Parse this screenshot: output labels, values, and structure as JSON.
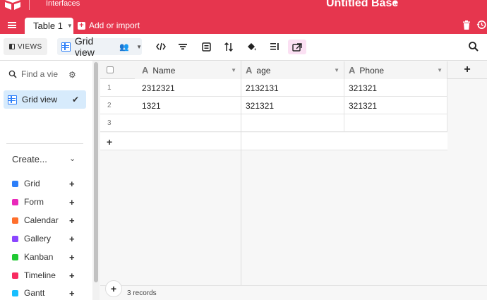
{
  "header": {
    "section_label": "Interfaces",
    "base_title": "Untitled Base"
  },
  "tabs": {
    "active_table": "Table 1",
    "add_import_label": "Add or import"
  },
  "viewbar": {
    "views_label": "VIEWS",
    "current_view": "Grid view",
    "tools": [
      "code-icon",
      "filter-icon",
      "group-icon",
      "sort-icon",
      "color-icon",
      "row-height-icon",
      "share-icon"
    ]
  },
  "sidebar": {
    "find_placeholder": "Find a view",
    "active_view": "Grid view",
    "create_label": "Create...",
    "create_items": [
      {
        "label": "Grid",
        "color": "#2d7ff9"
      },
      {
        "label": "Form",
        "color": "#e929ba"
      },
      {
        "label": "Calendar",
        "color": "#ff6f2c"
      },
      {
        "label": "Gallery",
        "color": "#8b46ff"
      },
      {
        "label": "Kanban",
        "color": "#20c933"
      },
      {
        "label": "Timeline",
        "color": "#f82b60"
      },
      {
        "label": "Gantt",
        "color": "#18bfff"
      }
    ]
  },
  "grid": {
    "columns": [
      "Name",
      "age",
      "Phone"
    ],
    "rows": [
      {
        "num": "1",
        "Name": "2312321",
        "age": "2132131",
        "Phone": "321321"
      },
      {
        "num": "2",
        "Name": "1321",
        "age": "321321",
        "Phone": "321321"
      },
      {
        "num": "3",
        "Name": "",
        "age": "",
        "Phone": ""
      }
    ],
    "records_label": "3 records"
  },
  "colors": {
    "brand": "#e6364e",
    "selected_view_bg": "#d7ebfc",
    "active_tool_bg": "#fbe0f3"
  }
}
